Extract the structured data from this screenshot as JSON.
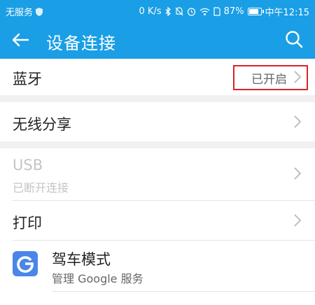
{
  "status_bar": {
    "carrier": "无服务",
    "speed": "0 K/s",
    "battery": "87%",
    "time": "中午12:15",
    "battery_level": 0.87
  },
  "app_bar": {
    "title": "设备连接"
  },
  "items": [
    {
      "label": "蓝牙",
      "value": "已开启"
    },
    {
      "label": "无线分享"
    },
    {
      "label": "USB",
      "sub": "已断开连接",
      "disabled": true
    },
    {
      "label": "打印"
    },
    {
      "label": "驾车模式",
      "sub": "管理 Google 服务"
    }
  ],
  "colors": {
    "accent": "#1a9ee6",
    "highlight": "#d8232a"
  }
}
